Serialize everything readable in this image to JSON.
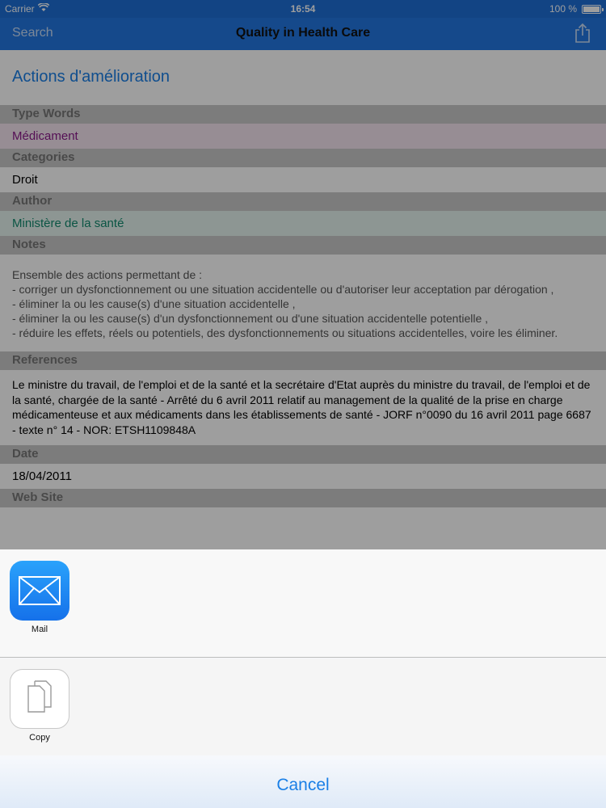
{
  "status_bar": {
    "carrier": "Carrier",
    "time": "16:54",
    "battery": "100 %",
    "battery_level": 1.0
  },
  "nav": {
    "back_label": "Search",
    "title": "Quality in Health Care",
    "share_icon": "share-icon"
  },
  "page": {
    "title": "Actions d'amélioration",
    "type_words": {
      "header": "Type Words",
      "value": "Médicament"
    },
    "categories": {
      "header": "Categories",
      "value": "Droit"
    },
    "author": {
      "header": "Author",
      "value": "Ministère de la santé"
    },
    "notes": {
      "header": "Notes",
      "value": "Ensemble des actions permettant de :\n- corriger un dysfonctionnement ou une situation accidentelle ou d'autoriser leur acceptation par dérogation ,\n- éliminer la ou les cause(s) d'une situation accidentelle ,\n- éliminer la ou les cause(s) d'un dysfonctionnement ou d'une situation accidentelle potentielle ,\n- réduire les effets, réels ou potentiels, des dysfonctionnements ou situations accidentelles, voire les éliminer."
    },
    "references": {
      "header": "References",
      "value": "Le ministre du travail, de l'emploi et de la santé et la secrétaire d'Etat auprès du ministre du travail, de l'emploi et de la santé, chargée de la santé -  Arrêté du 6 avril 2011 relatif au management de la qualité  de la prise en charge médicamenteuse  et aux médicaments dans les établissements de santé - JORF n°0090 du 16 avril 2011 page 6687 - texte n° 14 - NOR: ETSH1109848A"
    },
    "date": {
      "header": "Date",
      "value": "18/04/2011"
    },
    "website": {
      "header": "Web Site"
    }
  },
  "share_sheet": {
    "apps": [
      {
        "label": "Mail",
        "icon": "mail-icon"
      },
      {
        "label": "Copy",
        "icon": "copy-icon"
      }
    ],
    "cancel_label": "Cancel"
  }
}
